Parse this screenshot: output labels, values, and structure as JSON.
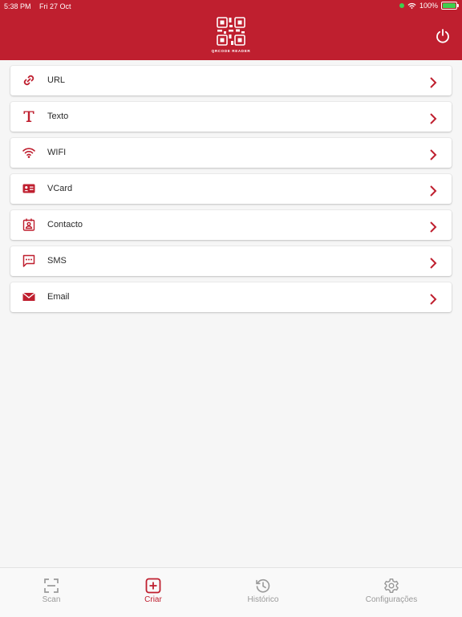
{
  "status_bar": {
    "time": "5:38 PM",
    "date": "Fri 27 Oct",
    "battery": "100%"
  },
  "header": {
    "logo_text": "QRCODE READER",
    "accent": "#bf1f2f"
  },
  "items": [
    {
      "label": "URL",
      "icon": "link-icon"
    },
    {
      "label": "Texto",
      "icon": "text-icon"
    },
    {
      "label": "WIFI",
      "icon": "wifi-icon"
    },
    {
      "label": "VCard",
      "icon": "vcard-icon"
    },
    {
      "label": "Contacto",
      "icon": "contact-icon"
    },
    {
      "label": "SMS",
      "icon": "sms-icon"
    },
    {
      "label": "Email",
      "icon": "email-icon"
    }
  ],
  "tabs": [
    {
      "label": "Scan",
      "icon": "scan-icon"
    },
    {
      "label": "Criar",
      "icon": "add-icon",
      "active": true
    },
    {
      "label": "Histórico",
      "icon": "history-icon"
    },
    {
      "label": "Configurações",
      "icon": "settings-icon"
    }
  ]
}
